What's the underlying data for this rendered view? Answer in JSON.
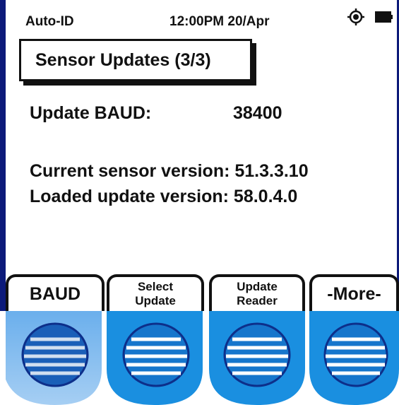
{
  "status": {
    "mode": "Auto-ID",
    "time": "12:00PM 20/Apr",
    "icons": [
      "gps-target-icon",
      "battery-icon"
    ]
  },
  "title": "Sensor Updates (3/3)",
  "baud": {
    "label": "Update BAUD:",
    "value": "38400"
  },
  "current_version": "Current sensor version: 51.3.3.10",
  "loaded_version": "Loaded update version: 58.0.4.0",
  "softkeys": [
    {
      "lines": [
        "BAUD"
      ]
    },
    {
      "lines": [
        "Select",
        "Update"
      ]
    },
    {
      "lines": [
        "Update",
        "Reader"
      ]
    },
    {
      "lines": [
        "-More-"
      ]
    }
  ],
  "colors": {
    "screen_edge": "#0c1a7a",
    "key_blue": "#1a8fe0",
    "key_dark": "#0d2f8a",
    "active_glow": "#7fb8ee"
  }
}
